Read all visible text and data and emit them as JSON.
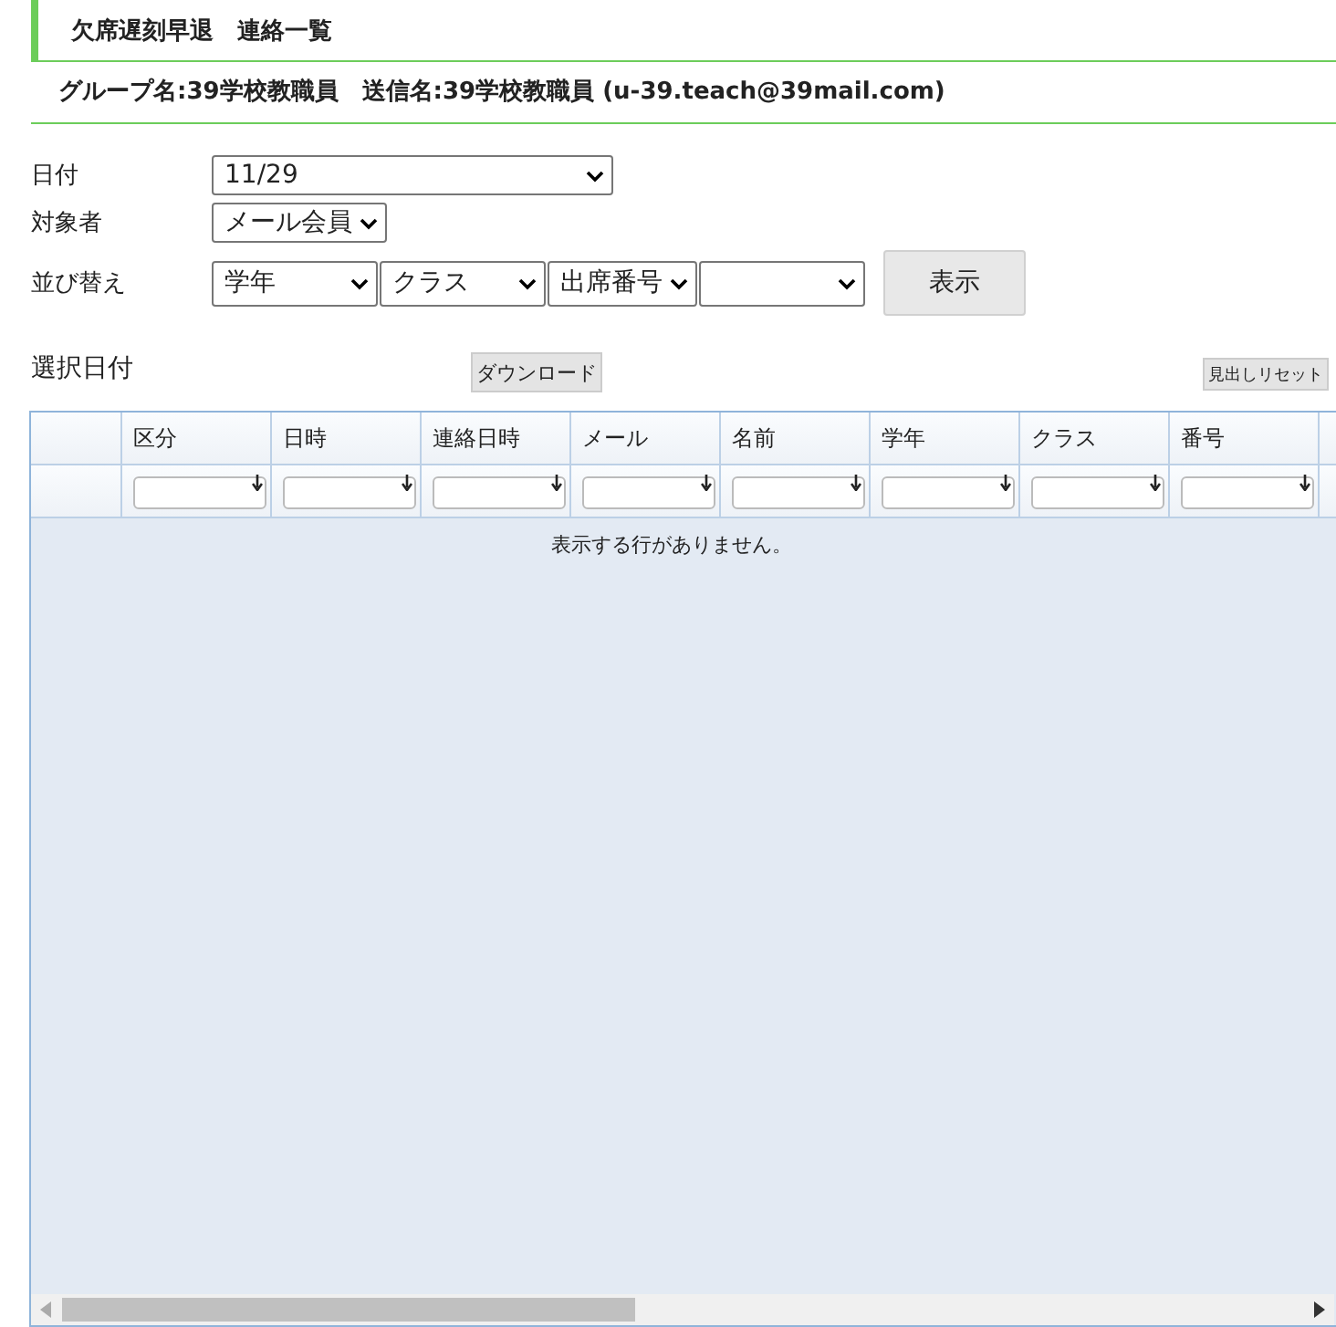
{
  "title": "欠席遅刻早退　連絡一覧",
  "subtitle": "グループ名:39学校教職員　送信名:39学校教職員 (u-39.teach@39mail.com)",
  "form": [
    {
      "label": "日付",
      "selects": [
        {
          "kind": "dropdown",
          "value": "11/29"
        }
      ]
    },
    {
      "label": "対象者",
      "selects": [
        {
          "kind": "dropdown",
          "value": "メール会員"
        }
      ]
    },
    {
      "label": "並び替え",
      "selects": [
        {
          "kind": "dropdown",
          "value": "学年"
        },
        {
          "kind": "dropdown",
          "value": "クラス"
        },
        {
          "kind": "dropdown",
          "value": "出席番号"
        },
        {
          "kind": "dropdown"
        }
      ],
      "button": "表示"
    }
  ],
  "grid": {
    "caption": "選択日付",
    "download_button": "ダウンロード",
    "reset_button": "見出しリセット",
    "columns": [
      "区分",
      "日時",
      "連絡日時",
      "メール",
      "名前",
      "学年",
      "クラス",
      "番号"
    ],
    "empty_message": "表示する行がありません。"
  }
}
